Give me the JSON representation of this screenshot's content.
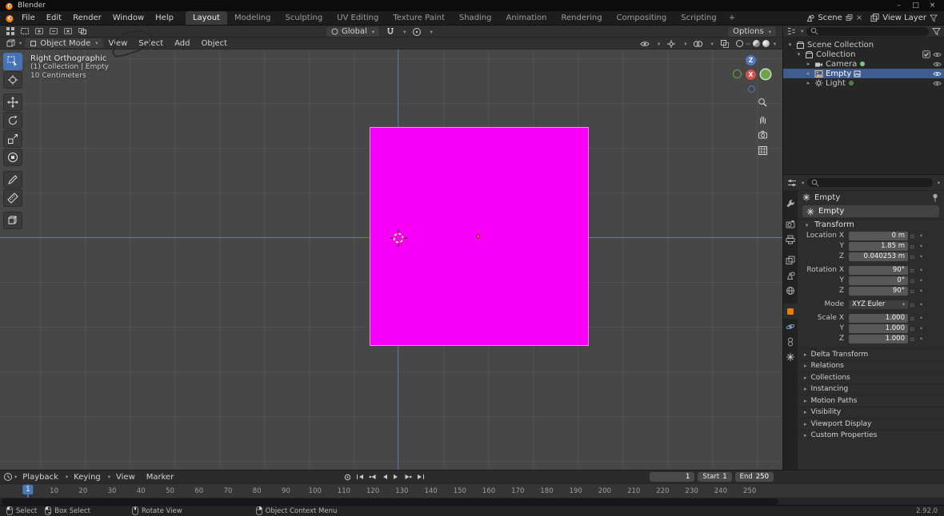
{
  "titlebar": {
    "app": "Blender",
    "minimize": "–",
    "maximize": "□",
    "close": "×"
  },
  "topbar": {
    "menus": [
      "File",
      "Edit",
      "Render",
      "Window",
      "Help"
    ],
    "workspaces": [
      "Layout",
      "Modeling",
      "Sculpting",
      "UV Editing",
      "Texture Paint",
      "Shading",
      "Animation",
      "Rendering",
      "Compositing",
      "Scripting"
    ],
    "add_tab": "+",
    "scene": "Scene",
    "view_layer": "View Layer"
  },
  "header": {
    "mode": "Object Mode",
    "menus": [
      "View",
      "Select",
      "Add",
      "Object"
    ],
    "orientation": "Global",
    "options": "Options"
  },
  "viewport": {
    "view_name": "Right Orthographic",
    "context": "(1) Collection | Empty",
    "scale": "10 Centimeters",
    "gizmo_z": "Z",
    "gizmo_x": "X"
  },
  "outliner": {
    "scene_collection": "Scene Collection",
    "collection": "Collection",
    "items": [
      {
        "label": "Camera"
      },
      {
        "label": "Empty"
      },
      {
        "label": "Light"
      }
    ]
  },
  "properties": {
    "breadcrumb": "Empty",
    "object_name": "Empty",
    "transform_title": "Transform",
    "rows": [
      {
        "label": "Location X",
        "value": "0 m"
      },
      {
        "label": "Y",
        "value": "1.85 m"
      },
      {
        "label": "Z",
        "value": "0.040253 m"
      },
      {
        "label": "Rotation X",
        "value": "90°"
      },
      {
        "label": "Y",
        "value": "0°"
      },
      {
        "label": "Z",
        "value": "90°"
      },
      {
        "label": "Mode",
        "value": "XYZ Euler"
      },
      {
        "label": "Scale X",
        "value": "1.000"
      },
      {
        "label": "Y",
        "value": "1.000"
      },
      {
        "label": "Z",
        "value": "1.000"
      }
    ],
    "sections": [
      "Delta Transform",
      "Relations",
      "Collections",
      "Instancing",
      "Motion Paths",
      "Visibility",
      "Viewport Display",
      "Custom Properties"
    ]
  },
  "timeline": {
    "menus": [
      "Playback",
      "Keying",
      "View",
      "Marker"
    ],
    "current_frame": "1",
    "playhead_label": "1",
    "start_label": "Start",
    "start_value": "1",
    "end_label": "End",
    "end_value": "250",
    "ticks": [
      "10",
      "20",
      "30",
      "40",
      "50",
      "60",
      "70",
      "80",
      "90",
      "100",
      "110",
      "120",
      "130",
      "140",
      "150",
      "160",
      "170",
      "180",
      "190",
      "200",
      "210",
      "220",
      "230",
      "240",
      "250"
    ]
  },
  "statusbar": {
    "items": [
      "Select",
      "Box Select",
      "Rotate View",
      "Object Context Menu"
    ],
    "version": "2.92.0"
  }
}
